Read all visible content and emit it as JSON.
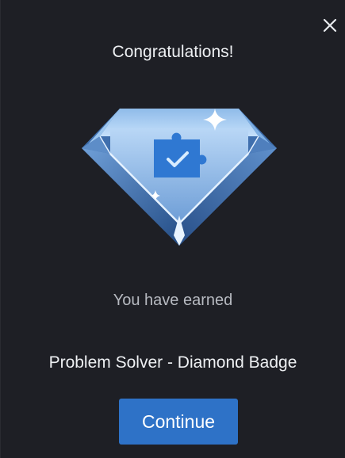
{
  "dialog": {
    "title": "Congratulations!",
    "subtitle": "You have earned",
    "badge_name": "Problem Solver - Diamond Badge",
    "continue_label": "Continue",
    "close_icon": "close-icon",
    "badge_icon": "diamond-badge-icon",
    "colors": {
      "background": "#1e1f25",
      "button": "#2e72c7",
      "diamond_light": "#aacdf2",
      "diamond_dark": "#2f5e9a"
    }
  }
}
